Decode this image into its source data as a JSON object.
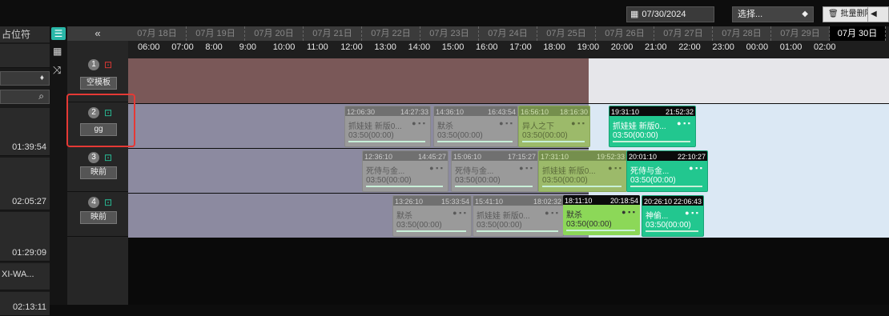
{
  "toolbar": {
    "date": "07/30/2024",
    "select_value": "选择...",
    "batch_delete": "批量删除",
    "back": "返"
  },
  "left": {
    "placeholder_label": "占位符",
    "times": [
      "01:39:54",
      "02:05:27",
      "01:29:09",
      "02:13:11"
    ],
    "item_label": "XI-WA..."
  },
  "timeline": {
    "dates": [
      "07月 18日",
      "07月 19日",
      "07月 20日",
      "07月 21日",
      "07月 22日",
      "07月 23日",
      "07月 24日",
      "07月 25日",
      "07月 26日",
      "07月 27日",
      "07月 28日",
      "07月 29日",
      "07月 30日"
    ],
    "hours": [
      "06:00",
      "07:00",
      "8:00",
      "9:00",
      "10:00",
      "11:00",
      "12:00",
      "13:00",
      "14:00",
      "15:00",
      "16:00",
      "17:00",
      "18:00",
      "19:00",
      "20:00",
      "21:00",
      "22:00",
      "23:00",
      "00:00",
      "01:00",
      "02:00"
    ],
    "collapse": "«"
  },
  "channels": [
    {
      "num": "1",
      "btn": "空模板",
      "cam_color": "#e53935"
    },
    {
      "num": "2",
      "btn": "gg",
      "cam_color": "#29c29b"
    },
    {
      "num": "3",
      "btn": "映前",
      "cam_color": "#29c29b"
    },
    {
      "num": "4",
      "btn": "映前",
      "cam_color": "#29c29b"
    }
  ],
  "blocks": {
    "r2": [
      {
        "s": "12:06:30",
        "e": "14:27:33",
        "n": "抓娃娃 新版0...",
        "d": "03:50(00:00)"
      },
      {
        "s": "14:36:10",
        "e": "16:43:54",
        "n": "默杀",
        "d": "03:50(00:00)"
      },
      {
        "s": "16:56:10",
        "e": "18:16:30",
        "n": "异人之下",
        "d": "03:50(00:00)"
      },
      {
        "s": "19:31:10",
        "e": "21:52:32",
        "n": "抓娃娃 新版0...",
        "d": "03:50(00:00)"
      }
    ],
    "r3": [
      {
        "s": "12:36:10",
        "e": "14:45:27",
        "n": "死侍与金...",
        "d": "03:50(00:00)"
      },
      {
        "s": "15:06:10",
        "e": "17:15:27",
        "n": "死侍与金...",
        "d": "03:50(00:00)"
      },
      {
        "s": "17:31:10",
        "e": "19:52:33",
        "n": "抓娃娃 新版0...",
        "d": "03:50(00:00)"
      },
      {
        "s": "20:01:10",
        "e": "22:10:27",
        "n": "死侍与金...",
        "d": "03:50(00:00)"
      }
    ],
    "r4": [
      {
        "s": "13:26:10",
        "e": "15:33:54",
        "n": "默杀",
        "d": "03:50(00:00)"
      },
      {
        "s": "15:41:10",
        "e": "18:02:32",
        "n": "抓娃娃 新版0...",
        "d": "03:50(00:00)"
      },
      {
        "s": "18:11:10",
        "e": "20:18:54",
        "n": "默杀",
        "d": "03:50(00:00)"
      },
      {
        "s": "20:26:10",
        "e": "22:06:43",
        "n": "神偷...",
        "d": "03:50(00:00)"
      }
    ]
  },
  "colors": {
    "accent": "#29b7a8",
    "green": "#22c78f",
    "highlight": "#e53935"
  }
}
